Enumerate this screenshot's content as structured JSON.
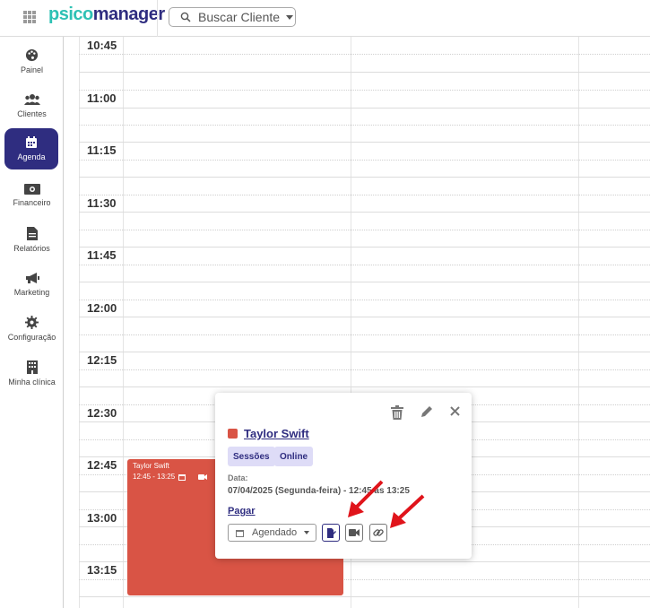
{
  "header": {
    "logo_part1": "psico",
    "logo_part2": "manager",
    "search_label": "Buscar Cliente"
  },
  "sidebar": {
    "items": [
      {
        "label": "Painel",
        "icon": "palette-icon"
      },
      {
        "label": "Clientes",
        "icon": "users-icon"
      },
      {
        "label": "Agenda",
        "icon": "calendar-icon",
        "active": true
      },
      {
        "label": "Financeiro",
        "icon": "money-icon"
      },
      {
        "label": "Relatórios",
        "icon": "file-icon"
      },
      {
        "label": "Marketing",
        "icon": "megaphone-icon"
      },
      {
        "label": "Configuração",
        "icon": "gear-icon"
      },
      {
        "label": "Minha clínica",
        "icon": "building-icon"
      }
    ]
  },
  "calendar": {
    "times": [
      "10:45",
      "11:00",
      "11:15",
      "11:30",
      "11:45",
      "12:00",
      "12:15",
      "12:30",
      "12:45",
      "13:00",
      "13:15"
    ]
  },
  "event": {
    "title": "Taylor Swift",
    "time": "12:45 - 13:25",
    "color": "#d95445"
  },
  "popover": {
    "client_name": "Taylor Swift",
    "tags": [
      "Sessões",
      "Online"
    ],
    "date_label": "Data:",
    "date_value": "07/04/2025 (Segunda-feira) - 12:45 às 13:25",
    "pay_link": "Pagar",
    "status": "Agendado"
  },
  "colors": {
    "brand": "#2f2d80",
    "accent": "#2ec1b4",
    "event": "#d95445",
    "annotation_arrow": "#e0141b"
  }
}
